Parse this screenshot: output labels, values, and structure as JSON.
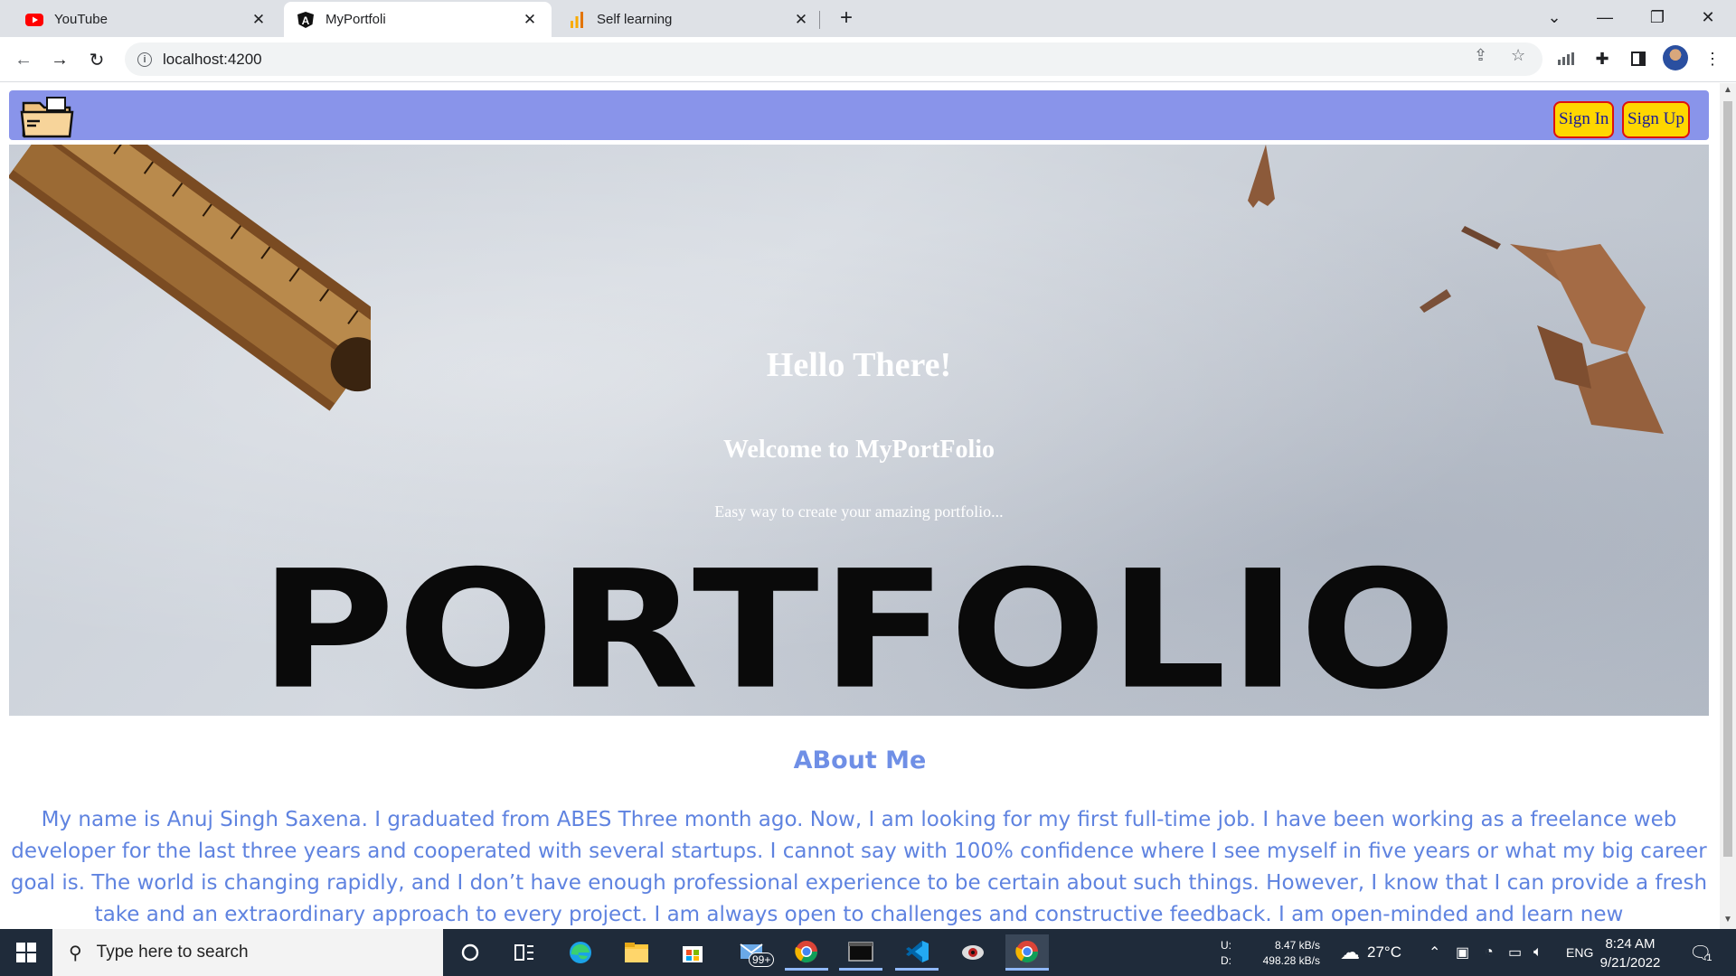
{
  "browser": {
    "tabs": [
      {
        "title": "YouTube",
        "icon": "youtube-icon",
        "active": false
      },
      {
        "title": "MyPortfoli",
        "icon": "angular-icon",
        "active": true
      },
      {
        "title": "Self learning",
        "icon": "analytics-icon",
        "active": false
      }
    ],
    "address": "localhost:4200"
  },
  "page": {
    "navbar": {
      "sign_in": "Sign In",
      "sign_up": "Sign Up",
      "colors": {
        "bar": "#8994ea",
        "button_bg": "#ffd700",
        "button_border": "#dd1111"
      }
    },
    "hero": {
      "heading": "Hello There!",
      "subheading": "Welcome to MyPortFolio",
      "tagline": "Easy way to create your amazing portfolio...",
      "image_text": "PORTFOLIO"
    },
    "about": {
      "title": "ABout Me",
      "text": "My name is Anuj Singh Saxena. I graduated from ABES Three month ago. Now, I am looking for my first full-time job. I have been working as a freelance web developer for the last three years and cooperated with several startups. I cannot say with 100% confidence where I see myself in five years or what my big career goal is. The world is changing rapidly, and I don’t have enough professional experience to be certain about such things. However, I know that I can provide a fresh take and an extraordinary approach to every project. I am always open to challenges and constructive feedback. I am open-minded and learn new"
    }
  },
  "taskbar": {
    "search_placeholder": "Type here to search",
    "mail_badge": "99+",
    "net_up_label": "U:",
    "net_up": "8.47 kB/s",
    "net_down_label": "D:",
    "net_down": "498.28 kB/s",
    "temperature": "27°C",
    "language": "ENG",
    "time": "8:24 AM",
    "date": "9/21/2022",
    "notification_count": "1"
  }
}
